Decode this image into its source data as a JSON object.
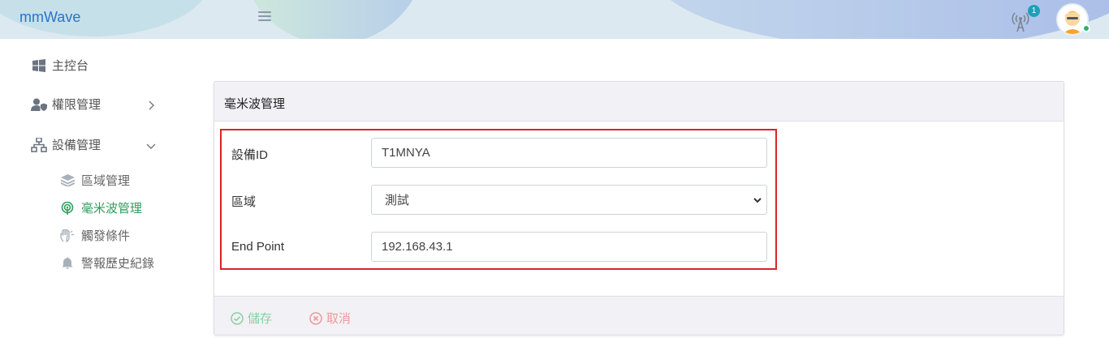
{
  "header": {
    "brand": "mmWave",
    "notification_count": "1",
    "colors": {
      "brand": "#2a73c8",
      "badge": "#1aa1b9",
      "status": "#2db36b"
    }
  },
  "sidebar": {
    "items": [
      {
        "label": "主控台",
        "icon": "windows-icon"
      },
      {
        "label": "權限管理",
        "icon": "user-shield-icon"
      },
      {
        "label": "設備管理",
        "icon": "network-icon"
      }
    ],
    "sub_items": [
      {
        "label": "區域管理",
        "icon": "layers-icon"
      },
      {
        "label": "毫米波管理",
        "icon": "radar-icon",
        "active": true
      },
      {
        "label": "觸發條件",
        "icon": "hand-icon"
      },
      {
        "label": "警報歷史紀錄",
        "icon": "bell-icon"
      }
    ],
    "active_color": "#2e9e5e"
  },
  "card": {
    "title": "毫米波管理",
    "fields": [
      {
        "label": "設備ID",
        "value": "T1MNYA"
      },
      {
        "label": "區域",
        "value": "測試"
      },
      {
        "label": "End Point",
        "value": "192.168.43.1"
      }
    ],
    "save_label": "儲存",
    "cancel_label": "取消",
    "highlight_color": "#d9232a"
  }
}
